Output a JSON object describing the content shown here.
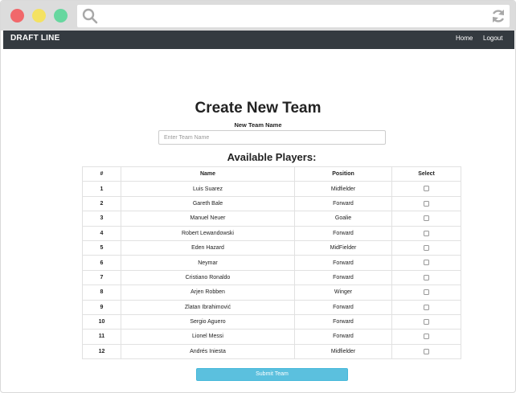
{
  "navbar": {
    "brand": "DRAFT LINE",
    "links": [
      "Home",
      "Logout"
    ]
  },
  "form": {
    "title": "Create New Team",
    "team_name_label": "New Team Name",
    "team_name_placeholder": "Enter Team Name",
    "team_name_value": "",
    "players_heading": "Available Players:",
    "submit_label": "Submit Team"
  },
  "table": {
    "columns": [
      "#",
      "Name",
      "Position",
      "Select"
    ],
    "rows": [
      {
        "num": "1",
        "name": "Luis Suarez",
        "position": "Midfielder",
        "selected": false
      },
      {
        "num": "2",
        "name": "Gareth Bale",
        "position": "Forward",
        "selected": false
      },
      {
        "num": "3",
        "name": "Manuel Neuer",
        "position": "Goalie",
        "selected": false
      },
      {
        "num": "4",
        "name": "Robert Lewandowski",
        "position": "Forward",
        "selected": false
      },
      {
        "num": "5",
        "name": "Eden Hazard",
        "position": "MidFielder",
        "selected": false
      },
      {
        "num": "6",
        "name": "Neymar",
        "position": "Forward",
        "selected": false
      },
      {
        "num": "7",
        "name": "Cristiano Ronaldo",
        "position": "Forward",
        "selected": false
      },
      {
        "num": "8",
        "name": "Arjen Robben",
        "position": "Winger",
        "selected": false
      },
      {
        "num": "9",
        "name": "Zlatan Ibrahimović",
        "position": "Forward",
        "selected": false
      },
      {
        "num": "10",
        "name": "Sergio Aguero",
        "position": "Forward",
        "selected": false
      },
      {
        "num": "11",
        "name": "Lionel Messi",
        "position": "Forward",
        "selected": false
      },
      {
        "num": "12",
        "name": "Andrés Iniesta",
        "position": "Midfielder",
        "selected": false
      }
    ]
  },
  "colors": {
    "navbar": "#343a40",
    "submit_button": "#5bc0de",
    "window_close": "#f1686b",
    "window_minimize": "#f4e262",
    "window_maximize": "#67d79f"
  }
}
